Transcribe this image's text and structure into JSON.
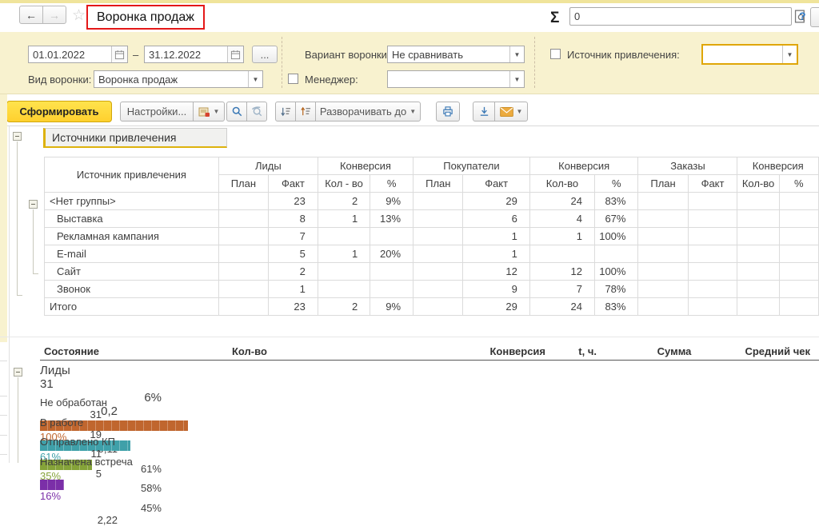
{
  "window": {
    "title": "Воронка продаж",
    "nav_back": "←",
    "nav_forward": "→",
    "favorite_star": "☆",
    "top_icons": [
      "save",
      "print",
      "preview",
      "link"
    ]
  },
  "filters": {
    "period_from": "01.01.2022",
    "period_dash": "–",
    "period_to": "31.12.2022",
    "period_more": "...",
    "funnel_kind_label": "Вид воронки:",
    "funnel_kind_value": "Воронка продаж",
    "variant_label": "Вариант воронки:",
    "variant_value": "Не сравнивать",
    "manager_label": "Менеджер:",
    "manager_value": "",
    "source_label": "Источник привлечения:",
    "source_value": ""
  },
  "toolbar": {
    "generate": "Сформировать",
    "settings": "Настройки...",
    "expand_to": "Разворачивать до",
    "caret": "▼",
    "sigma": "Σ",
    "sum_value": "0",
    "help": "?",
    "icons": [
      "report-variants",
      "search",
      "clear-search",
      "sort-descending",
      "sort-ascending",
      "print",
      "save-export",
      "send-email"
    ]
  },
  "colors": {
    "accent_yellow": "#ffd93b",
    "focus_gold": "#dfa608",
    "highlight_red": "#e41818",
    "panel_yellow": "#f8f2cf"
  },
  "report": {
    "section_title": "Источники привлечения",
    "table1": {
      "corner_header": "Источник привлечения",
      "groups": [
        "Лиды",
        "Конверсия",
        "Покупатели",
        "Конверсия",
        "Заказы",
        "Конверсия"
      ],
      "subcols": [
        "План",
        "Факт",
        "Кол - во",
        "%",
        "План",
        "Факт",
        "Кол-во",
        "%",
        "План",
        "Факт",
        "Кол-во",
        "%"
      ],
      "rows": [
        {
          "name": "<Нет группы>",
          "indent": false,
          "cells": [
            "",
            "23",
            "2",
            "9%",
            "",
            "29",
            "24",
            "83%",
            "",
            "",
            "",
            ""
          ]
        },
        {
          "name": "Выставка",
          "indent": true,
          "cells": [
            "",
            "8",
            "1",
            "13%",
            "",
            "6",
            "4",
            "67%",
            "",
            "",
            "",
            ""
          ]
        },
        {
          "name": "Рекламная кампания",
          "indent": true,
          "cells": [
            "",
            "7",
            "",
            "",
            "",
            "1",
            "1",
            "100%",
            "",
            "",
            "",
            ""
          ]
        },
        {
          "name": "E-mail",
          "indent": true,
          "cells": [
            "",
            "5",
            "1",
            "20%",
            "",
            "1",
            "",
            "",
            "",
            "",
            "",
            ""
          ]
        },
        {
          "name": "Сайт",
          "indent": true,
          "cells": [
            "",
            "2",
            "",
            "",
            "",
            "12",
            "12",
            "100%",
            "",
            "",
            "",
            ""
          ]
        },
        {
          "name": "Звонок",
          "indent": true,
          "cells": [
            "",
            "1",
            "",
            "",
            "",
            "9",
            "7",
            "78%",
            "",
            "",
            "",
            ""
          ]
        },
        {
          "name": "Итого",
          "indent": false,
          "cells": [
            "",
            "23",
            "2",
            "9%",
            "",
            "29",
            "24",
            "83%",
            "",
            "",
            "",
            ""
          ]
        }
      ]
    },
    "table2": {
      "headers": {
        "state": "Состояние",
        "count": "Кол-во",
        "conversion": "Конверсия",
        "time": "t, ч.",
        "sum": "Сумма",
        "avg_check": "Средний чек"
      },
      "group_row": {
        "name": "Лиды",
        "count": "31",
        "conversion": "6%",
        "time": "0,2"
      },
      "rows": [
        {
          "name": "Не обработан",
          "count": "31",
          "bar_pct": 100,
          "bar_label": "100%",
          "color": "#c0662e",
          "conversion": "",
          "time": "0,11"
        },
        {
          "name": "В работе",
          "count": "19",
          "bar_pct": 61,
          "bar_label": "61%",
          "color": "#3fa0a9",
          "conversion": "61%",
          "time": ""
        },
        {
          "name": "Отправлено КП",
          "count": "11",
          "bar_pct": 35,
          "bar_label": "35%",
          "color": "#85a339",
          "conversion": "58%",
          "time": ""
        },
        {
          "name": "Назначена встреча",
          "count": "5",
          "bar_pct": 16,
          "bar_label": "16%",
          "color": "#7b2fa8",
          "conversion": "45%",
          "time": "2,22"
        }
      ]
    }
  }
}
